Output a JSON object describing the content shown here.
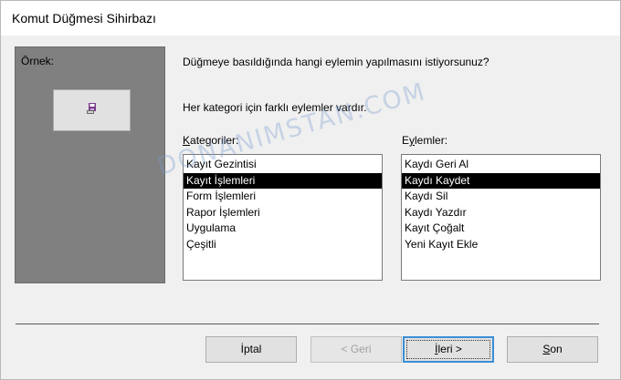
{
  "window": {
    "title": "Komut Düğmesi Sihirbazı"
  },
  "sample": {
    "label": "Örnek:",
    "icon": "save-record-icon"
  },
  "question": "Düğmeye basıldığında hangi eylemin yapılmasını istiyorsunuz?",
  "info": "Her kategori için farklı eylemler vardır.",
  "categories": {
    "label_mnemonic": "K",
    "label_rest": "ategoriler:",
    "items": [
      "Kayıt Gezintisi",
      "Kayıt İşlemleri",
      "Form İşlemleri",
      "Rapor İşlemleri",
      "Uygulama",
      "Çeşitli"
    ],
    "selected": "Kayıt İşlemleri"
  },
  "actions": {
    "label_pre": "E",
    "label_mnemonic": "y",
    "label_rest": "lemler:",
    "items": [
      "Kaydı Geri Al",
      "Kaydı Kaydet",
      "Kaydı Sil",
      "Kaydı Yazdır",
      "Kayıt Çoğalt",
      "Yeni Kayıt Ekle"
    ],
    "selected": "Kaydı Kaydet"
  },
  "buttons": {
    "cancel": "İptal",
    "back": "< Geri",
    "next_mnemonic": "İ",
    "next_rest": "leri >",
    "finish_mnemonic": "S",
    "finish_rest": "on"
  },
  "watermark": "DONANIMSTAN.COM",
  "colors": {
    "selection": "#000000",
    "default_button_border": "#3b8fd6",
    "sample_panel": "#808080"
  }
}
